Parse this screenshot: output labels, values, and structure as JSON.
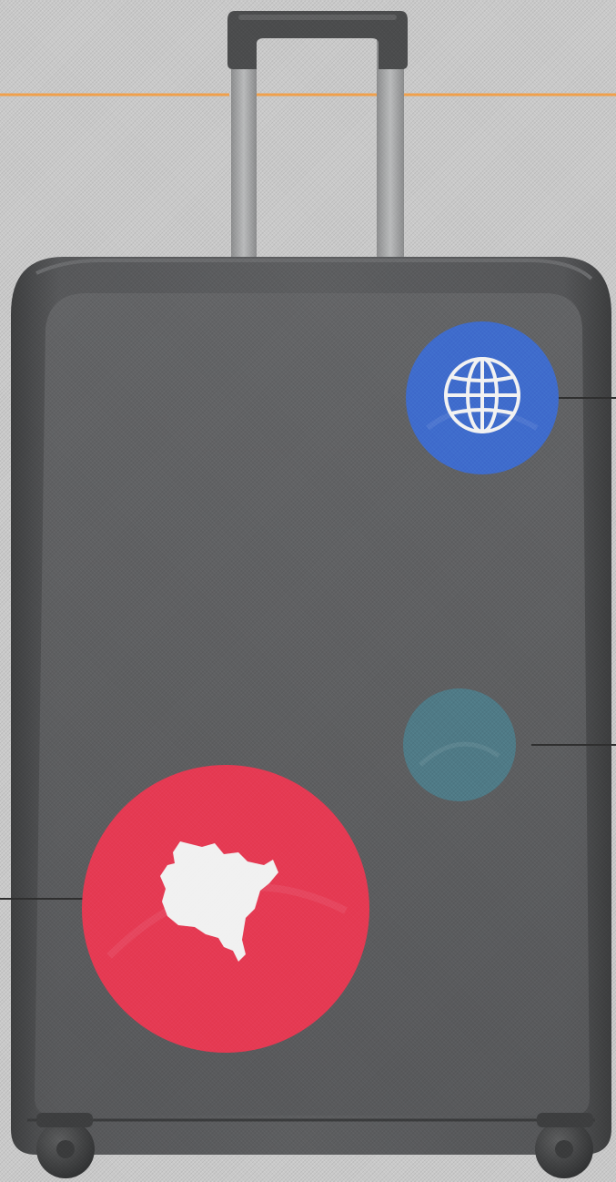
{
  "colors": {
    "background": "#c9c9c9",
    "accent_line": "#f0a04b",
    "suitcase_body": "#505152",
    "suitcase_panel": "#5c5d5f",
    "handle": "#a9aaab",
    "handle_grip": "#4b4c4d",
    "sticker_globe": "#3f6ccc",
    "sticker_teal": "#4f7a86",
    "sticker_map": "#e53a53",
    "sticker_map_shape": "#f1f1f1",
    "wheel": "#444546",
    "connector_line": "#2f2f2f"
  },
  "stickers": [
    {
      "name": "globe",
      "icon": "globe-icon"
    },
    {
      "name": "teal-blank",
      "icon": ""
    },
    {
      "name": "country-map",
      "icon": "country-map-icon"
    }
  ]
}
